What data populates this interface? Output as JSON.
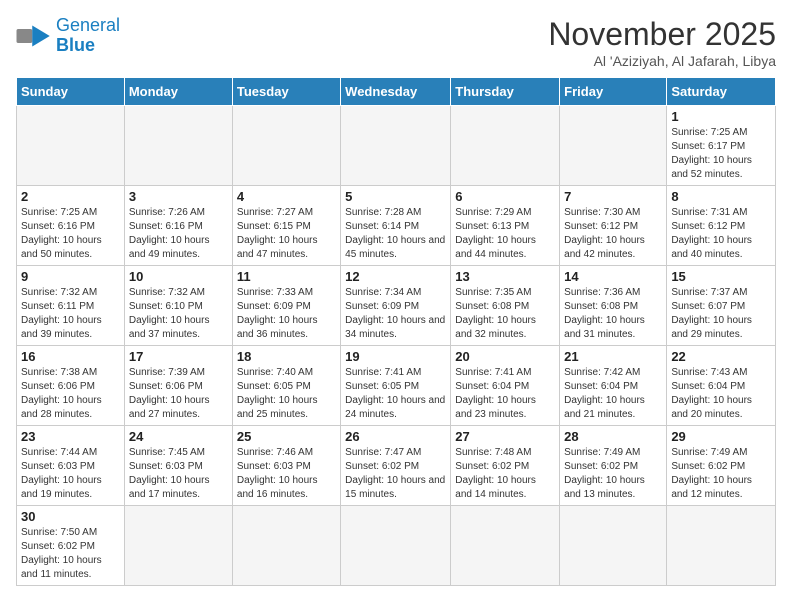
{
  "logo": {
    "text_general": "General",
    "text_blue": "Blue"
  },
  "header": {
    "month_year": "November 2025",
    "location": "Al 'Aziziyah, Al Jafarah, Libya"
  },
  "weekdays": [
    "Sunday",
    "Monday",
    "Tuesday",
    "Wednesday",
    "Thursday",
    "Friday",
    "Saturday"
  ],
  "weeks": [
    [
      {
        "day": "",
        "info": ""
      },
      {
        "day": "",
        "info": ""
      },
      {
        "day": "",
        "info": ""
      },
      {
        "day": "",
        "info": ""
      },
      {
        "day": "",
        "info": ""
      },
      {
        "day": "",
        "info": ""
      },
      {
        "day": "1",
        "info": "Sunrise: 7:25 AM\nSunset: 6:17 PM\nDaylight: 10 hours and 52 minutes."
      }
    ],
    [
      {
        "day": "2",
        "info": "Sunrise: 7:25 AM\nSunset: 6:16 PM\nDaylight: 10 hours and 50 minutes."
      },
      {
        "day": "3",
        "info": "Sunrise: 7:26 AM\nSunset: 6:16 PM\nDaylight: 10 hours and 49 minutes."
      },
      {
        "day": "4",
        "info": "Sunrise: 7:27 AM\nSunset: 6:15 PM\nDaylight: 10 hours and 47 minutes."
      },
      {
        "day": "5",
        "info": "Sunrise: 7:28 AM\nSunset: 6:14 PM\nDaylight: 10 hours and 45 minutes."
      },
      {
        "day": "6",
        "info": "Sunrise: 7:29 AM\nSunset: 6:13 PM\nDaylight: 10 hours and 44 minutes."
      },
      {
        "day": "7",
        "info": "Sunrise: 7:30 AM\nSunset: 6:12 PM\nDaylight: 10 hours and 42 minutes."
      },
      {
        "day": "8",
        "info": "Sunrise: 7:31 AM\nSunset: 6:12 PM\nDaylight: 10 hours and 40 minutes."
      }
    ],
    [
      {
        "day": "9",
        "info": "Sunrise: 7:32 AM\nSunset: 6:11 PM\nDaylight: 10 hours and 39 minutes."
      },
      {
        "day": "10",
        "info": "Sunrise: 7:32 AM\nSunset: 6:10 PM\nDaylight: 10 hours and 37 minutes."
      },
      {
        "day": "11",
        "info": "Sunrise: 7:33 AM\nSunset: 6:09 PM\nDaylight: 10 hours and 36 minutes."
      },
      {
        "day": "12",
        "info": "Sunrise: 7:34 AM\nSunset: 6:09 PM\nDaylight: 10 hours and 34 minutes."
      },
      {
        "day": "13",
        "info": "Sunrise: 7:35 AM\nSunset: 6:08 PM\nDaylight: 10 hours and 32 minutes."
      },
      {
        "day": "14",
        "info": "Sunrise: 7:36 AM\nSunset: 6:08 PM\nDaylight: 10 hours and 31 minutes."
      },
      {
        "day": "15",
        "info": "Sunrise: 7:37 AM\nSunset: 6:07 PM\nDaylight: 10 hours and 29 minutes."
      }
    ],
    [
      {
        "day": "16",
        "info": "Sunrise: 7:38 AM\nSunset: 6:06 PM\nDaylight: 10 hours and 28 minutes."
      },
      {
        "day": "17",
        "info": "Sunrise: 7:39 AM\nSunset: 6:06 PM\nDaylight: 10 hours and 27 minutes."
      },
      {
        "day": "18",
        "info": "Sunrise: 7:40 AM\nSunset: 6:05 PM\nDaylight: 10 hours and 25 minutes."
      },
      {
        "day": "19",
        "info": "Sunrise: 7:41 AM\nSunset: 6:05 PM\nDaylight: 10 hours and 24 minutes."
      },
      {
        "day": "20",
        "info": "Sunrise: 7:41 AM\nSunset: 6:04 PM\nDaylight: 10 hours and 23 minutes."
      },
      {
        "day": "21",
        "info": "Sunrise: 7:42 AM\nSunset: 6:04 PM\nDaylight: 10 hours and 21 minutes."
      },
      {
        "day": "22",
        "info": "Sunrise: 7:43 AM\nSunset: 6:04 PM\nDaylight: 10 hours and 20 minutes."
      }
    ],
    [
      {
        "day": "23",
        "info": "Sunrise: 7:44 AM\nSunset: 6:03 PM\nDaylight: 10 hours and 19 minutes."
      },
      {
        "day": "24",
        "info": "Sunrise: 7:45 AM\nSunset: 6:03 PM\nDaylight: 10 hours and 17 minutes."
      },
      {
        "day": "25",
        "info": "Sunrise: 7:46 AM\nSunset: 6:03 PM\nDaylight: 10 hours and 16 minutes."
      },
      {
        "day": "26",
        "info": "Sunrise: 7:47 AM\nSunset: 6:02 PM\nDaylight: 10 hours and 15 minutes."
      },
      {
        "day": "27",
        "info": "Sunrise: 7:48 AM\nSunset: 6:02 PM\nDaylight: 10 hours and 14 minutes."
      },
      {
        "day": "28",
        "info": "Sunrise: 7:49 AM\nSunset: 6:02 PM\nDaylight: 10 hours and 13 minutes."
      },
      {
        "day": "29",
        "info": "Sunrise: 7:49 AM\nSunset: 6:02 PM\nDaylight: 10 hours and 12 minutes."
      }
    ],
    [
      {
        "day": "30",
        "info": "Sunrise: 7:50 AM\nSunset: 6:02 PM\nDaylight: 10 hours and 11 minutes."
      },
      {
        "day": "",
        "info": ""
      },
      {
        "day": "",
        "info": ""
      },
      {
        "day": "",
        "info": ""
      },
      {
        "day": "",
        "info": ""
      },
      {
        "day": "",
        "info": ""
      },
      {
        "day": "",
        "info": ""
      }
    ]
  ]
}
